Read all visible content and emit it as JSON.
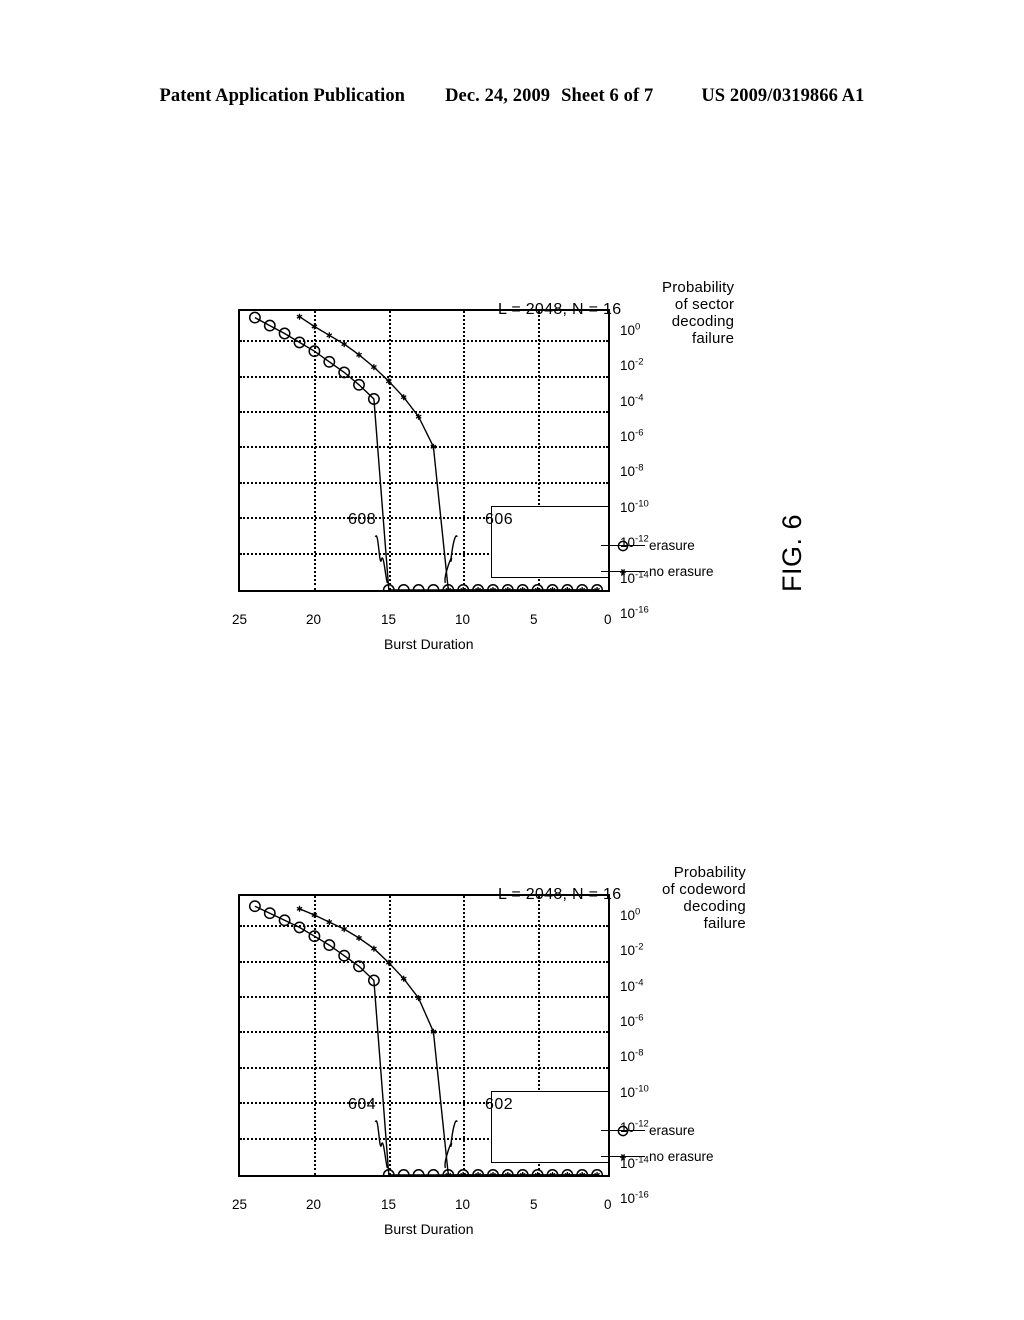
{
  "header": {
    "publication": "Patent Application Publication",
    "date": "Dec. 24, 2009",
    "sheet": "Sheet 6 of 7",
    "doc_number": "US 2009/0319866 A1"
  },
  "figure": {
    "caption": "FIG. 6"
  },
  "charts": [
    {
      "id": "top",
      "title": "L = 2048, N = 16",
      "ylabel": "Probability\nof sector\ndecoding\nfailure",
      "ylabel_lines": [
        "Probability",
        "of sector",
        "decoding",
        "failure"
      ],
      "xlabel": "Burst Duration",
      "legend": [
        {
          "label": "no erasure",
          "marker": "star"
        },
        {
          "label": "erasure",
          "marker": "circle"
        }
      ],
      "callouts": [
        {
          "text": "606"
        },
        {
          "text": "608"
        }
      ],
      "chart_data": {
        "type": "line",
        "title": "L = 2048, N = 16",
        "xlabel": "Burst Duration",
        "ylabel": "Probability of sector decoding failure",
        "xlim": [
          0,
          25
        ],
        "xticks": [
          0,
          5,
          10,
          15,
          20,
          25
        ],
        "ylim_exp": [
          -16,
          0
        ],
        "yticks": [
          "10^0",
          "10^-2",
          "10^-4",
          "10^-6",
          "10^-8",
          "10^-10",
          "10^-12",
          "10^-14",
          "10^-16"
        ],
        "ytick_labels": [
          "10",
          "10",
          "10",
          "10",
          "10",
          "10",
          "10",
          "10",
          "10"
        ],
        "ytick_exponents": [
          "0",
          "-2",
          "-4",
          "-6",
          "-8",
          "-10",
          "-12",
          "-14",
          "-16"
        ],
        "yscale": "log",
        "grid": true,
        "legend_position": "lower-left",
        "series": [
          {
            "name": "no erasure",
            "marker": "star",
            "x": [
              1,
              2,
              3,
              4,
              5,
              6,
              7,
              8,
              9,
              10,
              11,
              12,
              13,
              14,
              15,
              16,
              17,
              18,
              19,
              20,
              21
            ],
            "y_exp": [
              -16,
              -16,
              -16,
              -16,
              -16,
              -16,
              -16,
              -16,
              -16,
              -16,
              -16,
              -7.9,
              -6.2,
              -5.1,
              -4.2,
              -3.4,
              -2.7,
              -2.1,
              -1.6,
              -1.1,
              -0.55
            ]
          },
          {
            "name": "erasure",
            "marker": "circle",
            "x": [
              1,
              2,
              3,
              4,
              5,
              6,
              7,
              8,
              9,
              10,
              11,
              12,
              13,
              14,
              15,
              16,
              17,
              18,
              19,
              20,
              21,
              22,
              23,
              24
            ],
            "y_exp": [
              -16,
              -16,
              -16,
              -16,
              -16,
              -16,
              -16,
              -16,
              -16,
              -16,
              -16,
              -16,
              -16,
              -16,
              -16,
              -5.2,
              -4.4,
              -3.7,
              -3.1,
              -2.5,
              -2.0,
              -1.5,
              -1.05,
              -0.6
            ]
          }
        ],
        "annotations": [
          {
            "text": "606",
            "points_to_series": "no erasure"
          },
          {
            "text": "608",
            "points_to_series": "erasure"
          }
        ]
      }
    },
    {
      "id": "bottom",
      "title": "L = 2048, N = 16",
      "ylabel_lines": [
        "Probability",
        "of codeword",
        "decoding",
        "failure"
      ],
      "xlabel": "Burst Duration",
      "legend": [
        {
          "label": "no erasure",
          "marker": "star"
        },
        {
          "label": "erasure",
          "marker": "circle"
        }
      ],
      "callouts": [
        {
          "text": "602"
        },
        {
          "text": "604"
        }
      ],
      "chart_data": {
        "type": "line",
        "title": "L = 2048, N = 16",
        "xlabel": "Burst Duration",
        "ylabel": "Probability of codeword decoding failure",
        "xlim": [
          0,
          25
        ],
        "xticks": [
          0,
          5,
          10,
          15,
          20,
          25
        ],
        "ylim_exp": [
          -16,
          0
        ],
        "ytick_labels": [
          "10",
          "10",
          "10",
          "10",
          "10",
          "10",
          "10",
          "10",
          "10"
        ],
        "ytick_exponents": [
          "0",
          "-2",
          "-4",
          "-6",
          "-8",
          "-10",
          "-12",
          "-14",
          "-16"
        ],
        "yscale": "log",
        "grid": true,
        "legend_position": "lower-left",
        "series": [
          {
            "name": "no erasure",
            "marker": "star",
            "x": [
              1,
              2,
              3,
              4,
              5,
              6,
              7,
              8,
              9,
              10,
              11,
              12,
              13,
              14,
              15,
              16,
              17,
              18,
              19,
              20,
              21
            ],
            "y_exp": [
              -16,
              -16,
              -16,
              -16,
              -16,
              -16,
              -16,
              -16,
              -16,
              -16,
              -16,
              -7.9,
              -6.0,
              -4.9,
              -4.0,
              -3.2,
              -2.6,
              -2.1,
              -1.7,
              -1.3,
              -0.95
            ]
          },
          {
            "name": "erasure",
            "marker": "circle",
            "x": [
              1,
              2,
              3,
              4,
              5,
              6,
              7,
              8,
              9,
              10,
              11,
              12,
              13,
              14,
              15,
              16,
              17,
              18,
              19,
              20,
              21,
              22,
              23,
              24
            ],
            "y_exp": [
              -16,
              -16,
              -16,
              -16,
              -16,
              -16,
              -16,
              -16,
              -16,
              -16,
              -16,
              -16,
              -16,
              -16,
              -16,
              -5.0,
              -4.2,
              -3.6,
              -3.0,
              -2.5,
              -2.0,
              -1.6,
              -1.2,
              -0.8
            ]
          }
        ],
        "annotations": [
          {
            "text": "602",
            "points_to_series": "no erasure"
          },
          {
            "text": "604",
            "points_to_series": "erasure"
          }
        ]
      }
    }
  ]
}
